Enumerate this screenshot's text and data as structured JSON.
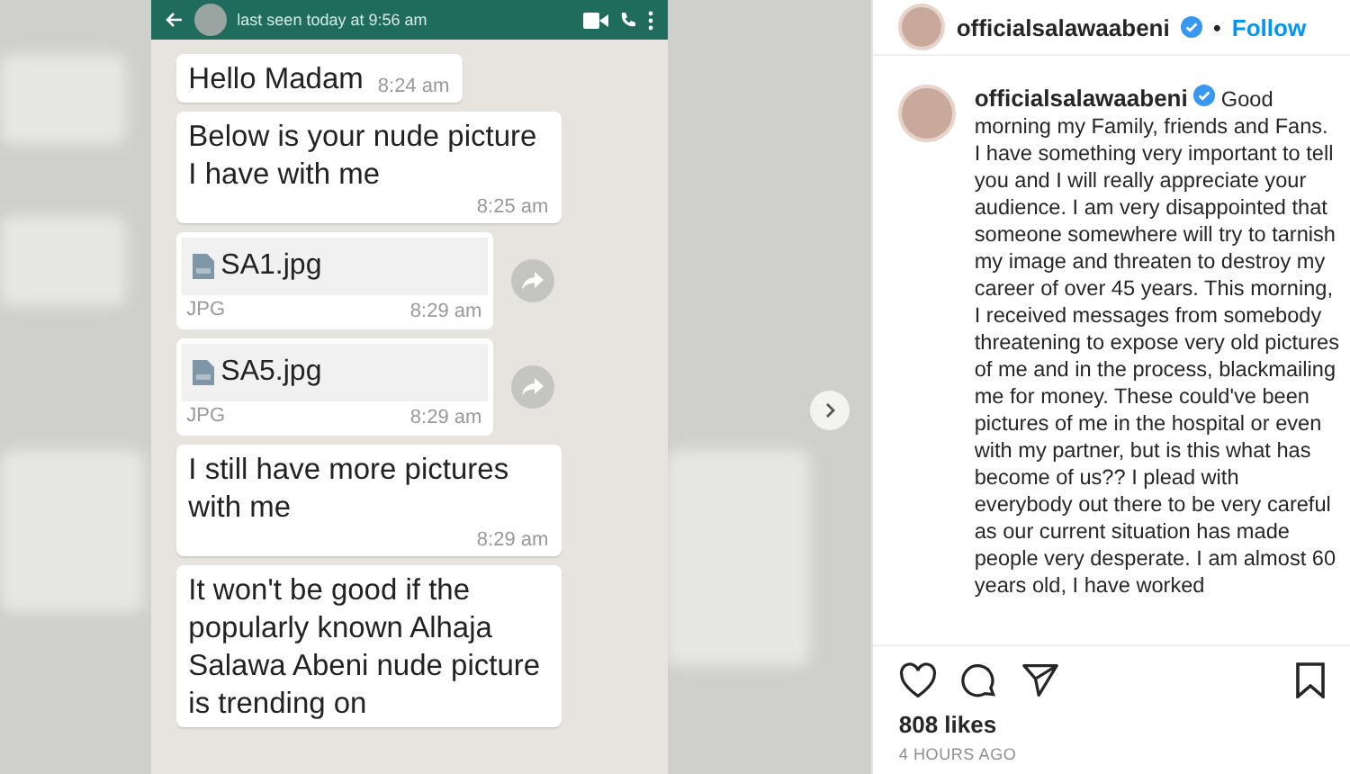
{
  "post_image": {
    "chat": {
      "header": {
        "status": "last seen today at 9:56 am"
      },
      "messages": [
        {
          "kind": "text",
          "text": "Hello Madam",
          "time": "8:24 am"
        },
        {
          "kind": "text",
          "text": "Below is your nude picture I have with me",
          "time": "8:25 am"
        },
        {
          "kind": "file",
          "filename": "SA1.jpg",
          "filetype": "JPG",
          "time": "8:29 am"
        },
        {
          "kind": "file",
          "filename": "SA5.jpg",
          "filetype": "JPG",
          "time": "8:29 am"
        },
        {
          "kind": "text",
          "text": "I still have more pictures with me",
          "time": "8:29 am"
        },
        {
          "kind": "text",
          "text": "It won't be good if the popularly known Alhaja Salawa Abeni nude picture is trending on"
        }
      ]
    }
  },
  "post": {
    "username": "officialsalawaabeni",
    "follow": "Follow",
    "separator": "•",
    "caption_username": "officialsalawaabeni",
    "caption": "Good morning my Family, friends and Fans. I have something very important to tell you and I will really appreciate your audience. I am very disappointed that someone somewhere will try to tarnish my image and threaten to destroy my career of over 45 years. This morning, I received messages from somebody threatening to expose very old pictures of me and in the process, blackmailing me for money. These could've been pictures of me in the hospital or even with my partner, but is this what has become of us?? I plead with everybody out there to be very careful as our current situation has made people very desperate. I am almost 60 years old, I have worked",
    "likes": "808 likes",
    "time": "4 HOURS AGO"
  }
}
